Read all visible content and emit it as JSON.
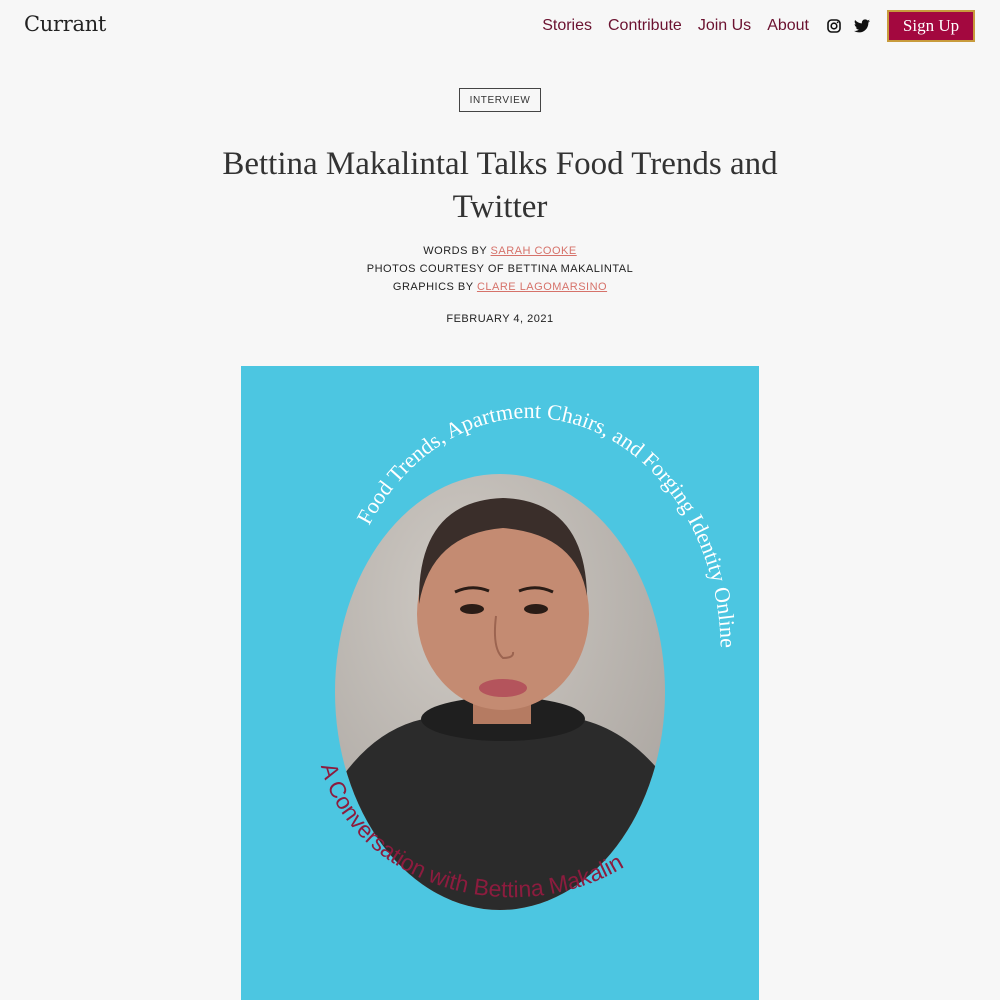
{
  "header": {
    "logo": "Currant",
    "nav": [
      "Stories",
      "Contribute",
      "Join Us",
      "About"
    ],
    "social_icons": [
      "instagram-icon",
      "twitter-icon"
    ],
    "signup_label": "Sign Up"
  },
  "article": {
    "category": "INTERVIEW",
    "title": "Bettina Makalintal Talks Food Trends and Twitter",
    "credits": {
      "words_prefix": "WORDS BY",
      "words_author": "SARAH COOKE",
      "photos": "PHOTOS COURTESY OF BETTINA MAKALINTAL",
      "graphics_prefix": "GRAPHICS BY",
      "graphics_author": "CLARE LAGOMARSINO"
    },
    "date": "FEBRUARY 4, 2021"
  },
  "hero": {
    "arc_top": "Food Trends, Apartment Chairs, and Forging Identity Online",
    "arc_bottom": "A Conversation with Bettina Makalintal",
    "colors": {
      "background": "#4cc6e1",
      "top_text": "#ffffff",
      "bottom_text": "#8c1c3e"
    }
  },
  "colors": {
    "accent": "#a3083f",
    "nav_text": "#6b1230",
    "link": "#d6726a"
  }
}
